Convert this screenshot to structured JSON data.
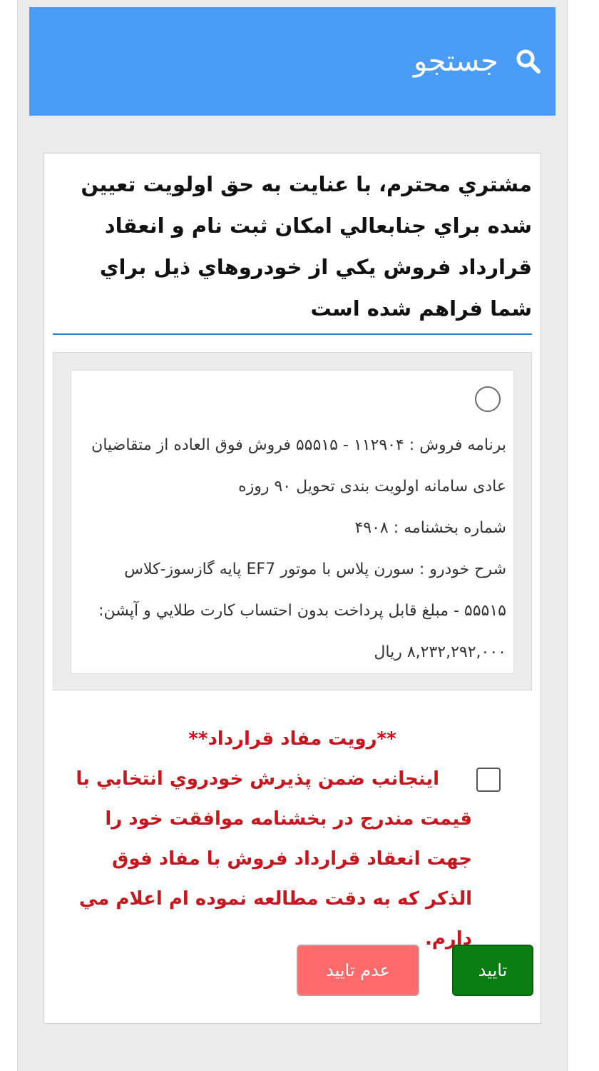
{
  "header": {
    "title": "جستجو",
    "icon": "search-icon",
    "background": "#4a9cf6"
  },
  "intro_text": "مشتري محترم، با عنايت به حق اولويت تعيين شده براي جنابعالي امكان ثبت نام و انعقاد قرارداد فروش يكي از خودروهاي ذيل براي شما فراهم شده است",
  "option": {
    "selected": false,
    "program_label": "برنامه فروش : ۱۱۲۹۰۴ - ۵۵۵۱۵ فروش فوق العاده از متقاضیان عادی سامانه اولویت بندی تحویل ۹۰ روزه",
    "circular_label": "شماره بخشنامه : ۴۹۰۸",
    "description": "شرح خودرو : سورن پلاس با موتور EF7 پایه گازسوز-کلاس ۵۵۵۱۵ - مبلغ قابل پرداخت بدون احتساب كارت طلايي و آپشن: ۸,۲۳۲,۲۹۲,۰۰۰ ريال"
  },
  "agreement": {
    "view_contract": "**رويت مفاد قرارداد**",
    "accept_text": "اينجانب ضمن پذيرش خودروي انتخابي با قيمت مندرج در بخشنامه موافقت خود را جهت انعقاد قرارداد فروش با مفاد فوق الذكر كه به دقت مطالعه نموده ام اعلام مي دارم.",
    "checked": false,
    "accent_color": "#c8161d"
  },
  "buttons": {
    "confirm": "تاييد",
    "reject": "عدم تاييد",
    "confirm_color": "#0a7d12",
    "reject_color": "#ff6b6b"
  }
}
